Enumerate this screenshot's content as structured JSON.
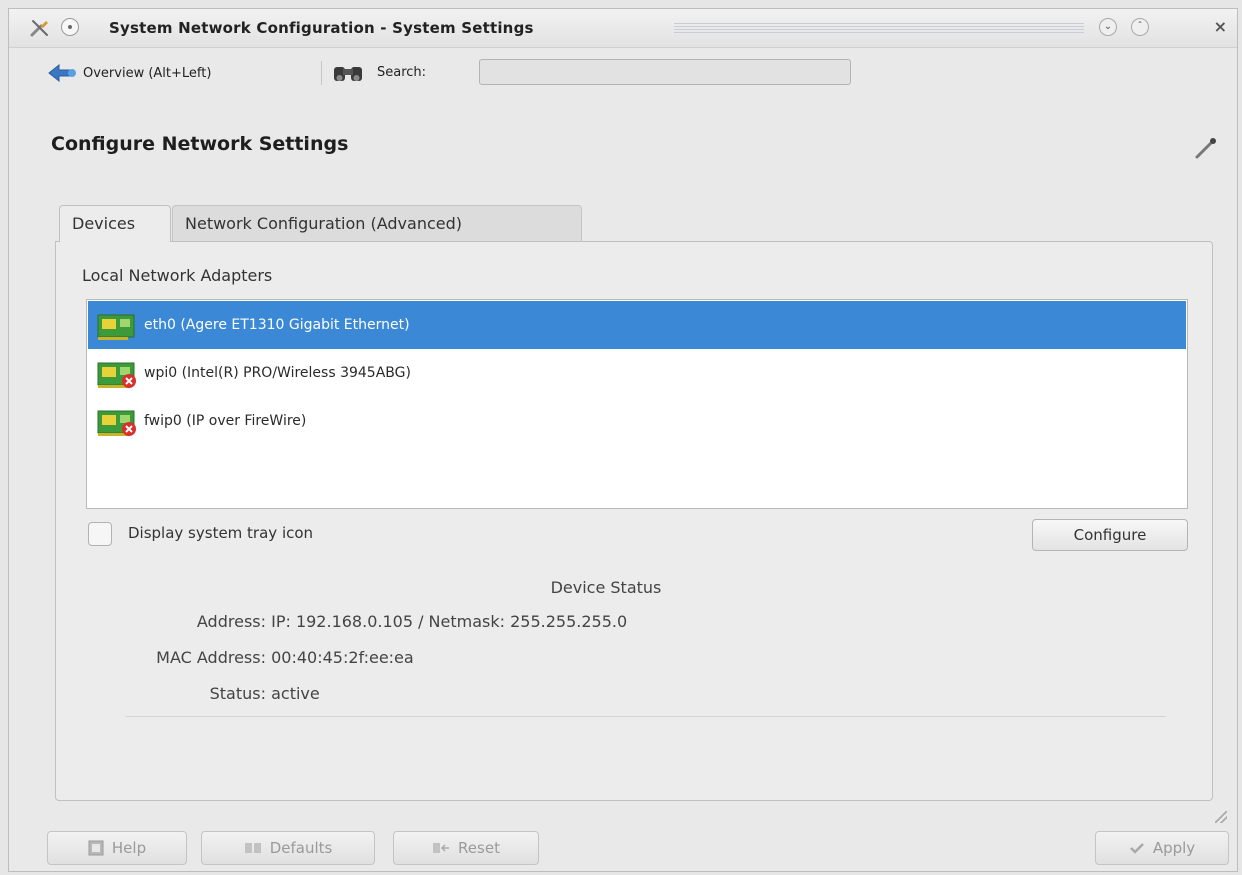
{
  "window": {
    "title": "System Network Configuration - System Settings"
  },
  "toolbar": {
    "overview_label": "Overview (Alt+Left)",
    "search_label": "Search:",
    "search_value": ""
  },
  "page": {
    "heading": "Configure Network Settings"
  },
  "tabs": [
    {
      "label": "Devices",
      "active": true
    },
    {
      "label": "Network Configuration (Advanced)",
      "active": false
    }
  ],
  "devices": {
    "group_label": "Local Network Adapters",
    "adapters": [
      {
        "name": "eth0 (Agere ET1310 Gigabit Ethernet)",
        "selected": true,
        "active": true
      },
      {
        "name": "wpi0 (Intel(R) PRO/Wireless 3945ABG)",
        "selected": false,
        "active": false
      },
      {
        "name": "fwip0 (IP over FireWire)",
        "selected": false,
        "active": false
      }
    ],
    "tray_checkbox_label": "Display system tray icon",
    "tray_checked": false,
    "configure_label": "Configure"
  },
  "device_status": {
    "title": "Device Status",
    "address_label": "Address:",
    "address_value": "IP: 192.168.0.105 / Netmask: 255.255.255.0",
    "mac_label": "MAC Address:",
    "mac_value": "00:40:45:2f:ee:ea",
    "status_label": "Status:",
    "status_value": "active"
  },
  "buttons": {
    "help": "Help",
    "defaults": "Defaults",
    "reset": "Reset",
    "apply": "Apply"
  },
  "colors": {
    "selection": "#3a88d6",
    "disconnected_badge": "#d9302c"
  }
}
